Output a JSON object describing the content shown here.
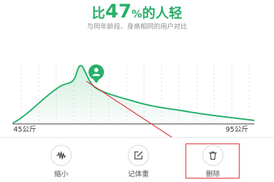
{
  "headline": {
    "prefix": "比",
    "value": "47",
    "unit": "%",
    "suffix": "的人轻"
  },
  "subtitle": "与同年龄段、身高相同的用户对比",
  "axis": {
    "min_label": "45公斤",
    "max_label": "95公斤"
  },
  "toolbar": {
    "shrink_label": "缩小",
    "record_label": "记体重",
    "delete_label": "删除"
  },
  "colors": {
    "accent": "#29b06a",
    "annotation": "#e03131"
  }
}
